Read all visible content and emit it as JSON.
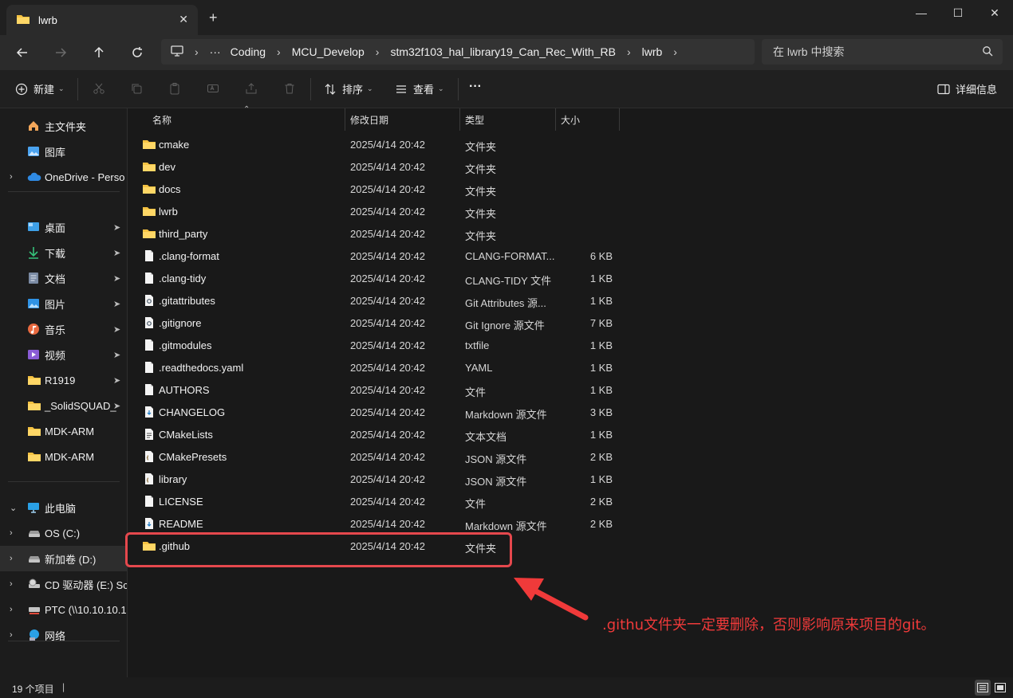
{
  "window": {
    "tab_title": "lwrb",
    "new_tab_icon": "+",
    "minimize": "—",
    "maximize": "☐",
    "close": "✕"
  },
  "address": {
    "crumbs": [
      "···",
      "Coding",
      "MCU_Develop",
      "stm32f103_hal_library19_Can_Rec_With_RB",
      "lwrb"
    ],
    "search_placeholder": "在 lwrb 中搜索"
  },
  "commands": {
    "new_label": "新建",
    "sort_label": "排序",
    "view_label": "查看",
    "more_label": "···",
    "details_label": "详细信息"
  },
  "sidebar": {
    "items": [
      {
        "label": "主文件夹",
        "icon": "home-icon",
        "chevron": "",
        "pinned": false
      },
      {
        "label": "图库",
        "icon": "gallery-icon",
        "chevron": "",
        "pinned": false
      },
      {
        "label": "OneDrive - Perso",
        "icon": "cloud-icon",
        "chevron": "›",
        "pinned": false
      },
      {
        "label": "桌面",
        "icon": "desktop-icon",
        "chevron": "",
        "pinned": true
      },
      {
        "label": "下载",
        "icon": "download-icon",
        "chevron": "",
        "pinned": true
      },
      {
        "label": "文档",
        "icon": "documents-icon",
        "chevron": "",
        "pinned": true
      },
      {
        "label": "图片",
        "icon": "pictures-icon",
        "chevron": "",
        "pinned": true
      },
      {
        "label": "音乐",
        "icon": "music-icon",
        "chevron": "",
        "pinned": true
      },
      {
        "label": "视频",
        "icon": "video-icon",
        "chevron": "",
        "pinned": true
      },
      {
        "label": "R1919",
        "icon": "folder-icon",
        "chevron": "",
        "pinned": true
      },
      {
        "label": "_SolidSQUAD_",
        "icon": "folder-icon",
        "chevron": "",
        "pinned": true
      },
      {
        "label": "MDK-ARM",
        "icon": "folder-icon",
        "chevron": "",
        "pinned": false
      },
      {
        "label": "MDK-ARM",
        "icon": "folder-icon",
        "chevron": "",
        "pinned": false
      },
      {
        "label": "此电脑",
        "icon": "pc-icon",
        "chevron": "⌄",
        "pinned": false
      },
      {
        "label": "OS (C:)",
        "icon": "drive-icon",
        "chevron": "›",
        "pinned": false
      },
      {
        "label": "新加卷 (D:)",
        "icon": "drive-icon",
        "chevron": "›",
        "pinned": false
      },
      {
        "label": "CD 驱动器 (E:) Sc",
        "icon": "cd-drive-icon",
        "chevron": "›",
        "pinned": false
      },
      {
        "label": "PTC (\\\\10.10.10.1",
        "icon": "network-drive-icon",
        "chevron": "›",
        "pinned": false
      },
      {
        "label": "网络",
        "icon": "network-icon",
        "chevron": "›",
        "pinned": false
      }
    ],
    "pin_glyph": "📌"
  },
  "columns": {
    "name": "名称",
    "date": "修改日期",
    "type": "类型",
    "size": "大小"
  },
  "files": [
    {
      "name": "cmake",
      "date": "2025/4/14 20:42",
      "type": "文件夹",
      "size": "",
      "kind": "folder"
    },
    {
      "name": "dev",
      "date": "2025/4/14 20:42",
      "type": "文件夹",
      "size": "",
      "kind": "folder"
    },
    {
      "name": "docs",
      "date": "2025/4/14 20:42",
      "type": "文件夹",
      "size": "",
      "kind": "folder"
    },
    {
      "name": "lwrb",
      "date": "2025/4/14 20:42",
      "type": "文件夹",
      "size": "",
      "kind": "folder"
    },
    {
      "name": "third_party",
      "date": "2025/4/14 20:42",
      "type": "文件夹",
      "size": "",
      "kind": "folder"
    },
    {
      "name": ".clang-format",
      "date": "2025/4/14 20:42",
      "type": "CLANG-FORMAT...",
      "size": "6 KB",
      "kind": "file"
    },
    {
      "name": ".clang-tidy",
      "date": "2025/4/14 20:42",
      "type": "CLANG-TIDY 文件",
      "size": "1 KB",
      "kind": "file"
    },
    {
      "name": ".gitattributes",
      "date": "2025/4/14 20:42",
      "type": "Git Attributes 源...",
      "size": "1 KB",
      "kind": "gear"
    },
    {
      "name": ".gitignore",
      "date": "2025/4/14 20:42",
      "type": "Git Ignore 源文件",
      "size": "7 KB",
      "kind": "gear"
    },
    {
      "name": ".gitmodules",
      "date": "2025/4/14 20:42",
      "type": "txtfile",
      "size": "1 KB",
      "kind": "file"
    },
    {
      "name": ".readthedocs.yaml",
      "date": "2025/4/14 20:42",
      "type": "YAML",
      "size": "1 KB",
      "kind": "file"
    },
    {
      "name": "AUTHORS",
      "date": "2025/4/14 20:42",
      "type": "文件",
      "size": "1 KB",
      "kind": "file"
    },
    {
      "name": "CHANGELOG",
      "date": "2025/4/14 20:42",
      "type": "Markdown 源文件",
      "size": "3 KB",
      "kind": "markdown"
    },
    {
      "name": "CMakeLists",
      "date": "2025/4/14 20:42",
      "type": "文本文档",
      "size": "1 KB",
      "kind": "text"
    },
    {
      "name": "CMakePresets",
      "date": "2025/4/14 20:42",
      "type": "JSON 源文件",
      "size": "2 KB",
      "kind": "json"
    },
    {
      "name": "library",
      "date": "2025/4/14 20:42",
      "type": "JSON 源文件",
      "size": "1 KB",
      "kind": "json"
    },
    {
      "name": "LICENSE",
      "date": "2025/4/14 20:42",
      "type": "文件",
      "size": "2 KB",
      "kind": "file"
    },
    {
      "name": "README",
      "date": "2025/4/14 20:42",
      "type": "Markdown 源文件",
      "size": "2 KB",
      "kind": "markdown"
    },
    {
      "name": ".github",
      "date": "2025/4/14 20:42",
      "type": "文件夹",
      "size": "",
      "kind": "folder"
    }
  ],
  "annotation": {
    "text": ".githu文件夹一定要删除，否则影响原来项目的git。",
    "color": "#f03a3a"
  },
  "status": {
    "count": "19 个项目",
    "separator": "|"
  },
  "colors": {
    "folder": "#f5c242",
    "accent": "#4cc2ff",
    "highlight": "#e5484d"
  }
}
